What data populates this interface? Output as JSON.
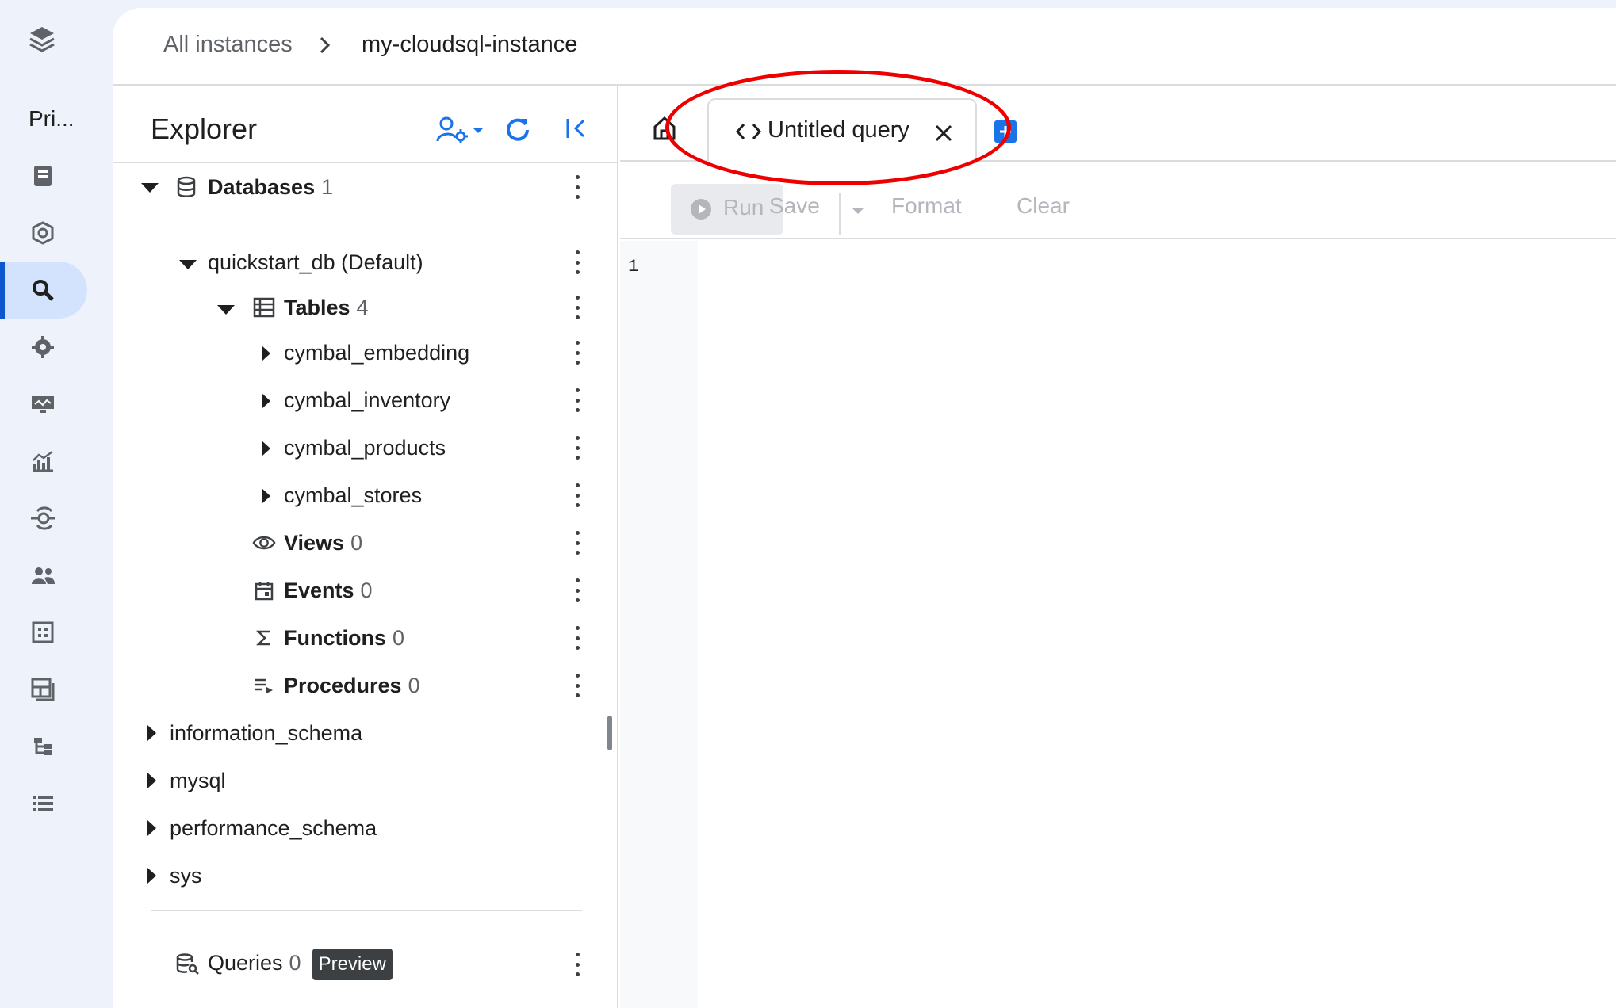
{
  "rail": {
    "label": "Pri...",
    "icons": [
      "layers-icon",
      "book-icon",
      "shield-icon",
      "search-icon",
      "settings-icon",
      "monitor-icon",
      "analytics-icon",
      "connection-icon",
      "users-icon",
      "grid-icon",
      "panels-icon",
      "hierarchy-icon",
      "list-icon"
    ],
    "active": "search-icon"
  },
  "breadcrumb": {
    "parent": "All instances",
    "current": "my-cloudsql-instance"
  },
  "explorer": {
    "title": "Explorer",
    "tree": {
      "databases": {
        "label": "Databases",
        "count": "1"
      },
      "db": {
        "label": "quickstart_db (Default)"
      },
      "tables": {
        "label": "Tables",
        "count": "4"
      },
      "table_items": [
        "cymbal_embedding",
        "cymbal_inventory",
        "cymbal_products",
        "cymbal_stores"
      ],
      "views": {
        "label": "Views",
        "count": "0"
      },
      "events": {
        "label": "Events",
        "count": "0"
      },
      "functions": {
        "label": "Functions",
        "count": "0"
      },
      "procedures": {
        "label": "Procedures",
        "count": "0"
      },
      "schemas": [
        "information_schema",
        "mysql",
        "performance_schema",
        "sys"
      ]
    },
    "queries": {
      "label": "Queries",
      "count": "0",
      "badge": "Preview"
    }
  },
  "editor": {
    "tab_label": "Untitled query",
    "toolbar": {
      "run": "Run",
      "save": "Save",
      "format": "Format",
      "clear": "Clear"
    },
    "line_number": "1"
  },
  "colors": {
    "accent": "#1a73e8",
    "highlight": "#e00000",
    "rail_active": "#d3e3fd"
  }
}
